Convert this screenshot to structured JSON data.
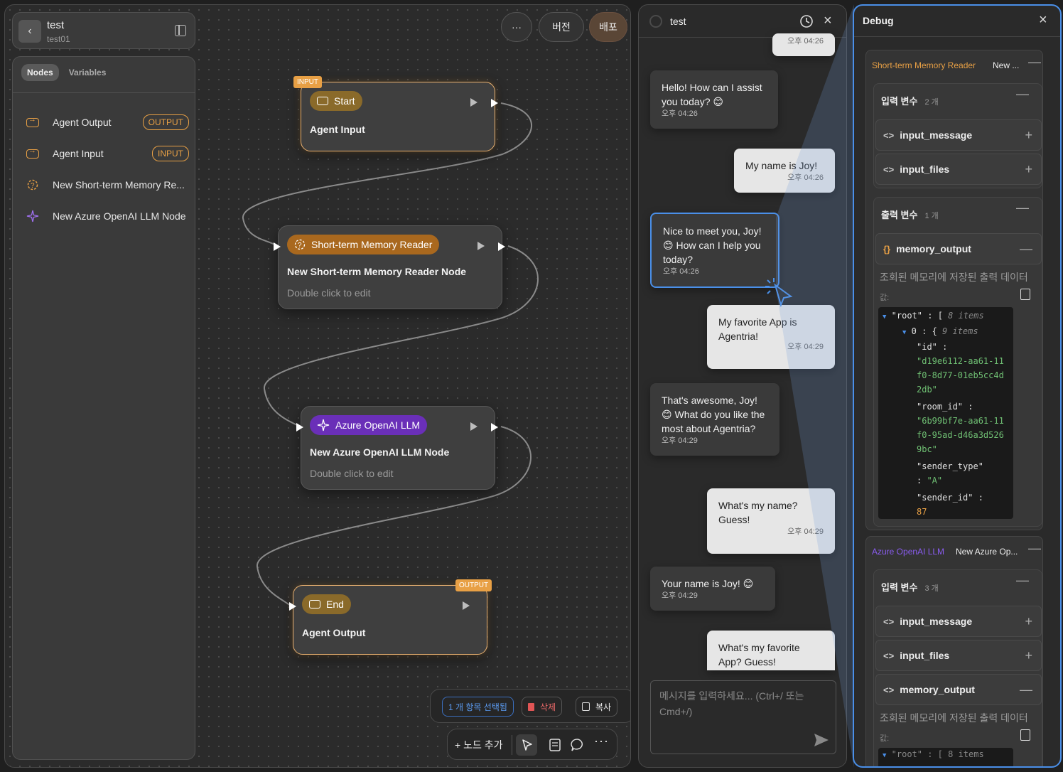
{
  "project": {
    "title": "test",
    "subtitle": "test01"
  },
  "node_panel": {
    "tabs": [
      "Nodes",
      "Variables"
    ],
    "items": [
      {
        "label": "Agent Output",
        "badge": "OUTPUT",
        "icon": "io-icon"
      },
      {
        "label": "Agent Input",
        "badge": "INPUT",
        "icon": "io-icon"
      },
      {
        "label": "New Short-term Memory Re...",
        "badge": "",
        "icon": "memory-icon"
      },
      {
        "label": "New Azure OpenAI LLM Node",
        "badge": "",
        "icon": "sparkle-icon"
      }
    ]
  },
  "top_actions": {
    "more": "···",
    "version": "버전",
    "deploy": "배포"
  },
  "nodes": {
    "start": {
      "tag": "INPUT",
      "pill": "Start",
      "title": "Agent Input"
    },
    "memory": {
      "pill": "Short-term Memory Reader",
      "title": "New Short-term Memory Reader Node",
      "sub": "Double click to edit"
    },
    "llm": {
      "pill": "Azure OpenAI LLM",
      "title": "New Azure OpenAI LLM Node",
      "sub": "Double click to edit"
    },
    "end": {
      "tag": "OUTPUT",
      "pill": "End",
      "title": "Agent Output"
    }
  },
  "selection_bar": {
    "selected": "1 개 항목 선택됨",
    "delete": "삭제",
    "copy": "복사"
  },
  "tool_bar": {
    "add_node": "+ 노드 추가"
  },
  "chat": {
    "title": "test",
    "partial_time": "오후 04:26",
    "messages": [
      {
        "role": "bot",
        "text": "Hello! How can I assist you today? 😊",
        "time": "오후 04:26"
      },
      {
        "role": "user",
        "text": "My name is Joy!",
        "time": "오후 04:26"
      },
      {
        "role": "bot",
        "text": "Nice to meet you, Joy! 😊 How can I help you today?",
        "time": "오후 04:26"
      },
      {
        "role": "user",
        "text": "My favorite App is Agentria!",
        "time": "오후 04:29"
      },
      {
        "role": "bot",
        "text": "That's awesome, Joy! 😊 What do you like the most about Agentria?",
        "time": "오후 04:29"
      },
      {
        "role": "user",
        "text": "What's my name? Guess!",
        "time": "오후 04:29"
      },
      {
        "role": "bot",
        "text": "Your name is Joy! 😊",
        "time": "오후 04:29"
      },
      {
        "role": "user",
        "text": "What's my favorite App? Guess!",
        "time": ""
      }
    ],
    "input_placeholder": "메시지를 입력하세요... (Ctrl+/ 또는 Cmd+/)"
  },
  "debug": {
    "title": "Debug",
    "sections": [
      {
        "type_label": "Short-term Memory Reader",
        "name": "New ...",
        "type_color": "#e8a045",
        "inputs_label": "입력 변수",
        "inputs_count": "2 개",
        "inputs": [
          "input_message",
          "input_files"
        ],
        "outputs_label": "출력 변수",
        "outputs_count": "1 개",
        "outputs": [
          "memory_output"
        ],
        "output_desc": "조회된 메모리에 저장된 출력 데이터",
        "value_label": "값:",
        "json": {
          "root_key": "\"root\"",
          "root_meta": "8 items",
          "idx_key": "0",
          "idx_meta": "9 items",
          "fields": [
            {
              "key": "\"id\"",
              "value": "\"d19e6112-aa61-11f0-8d77-01eb5cc4d2db\"",
              "kind": "string"
            },
            {
              "key": "\"room_id\"",
              "value": "\"6b99bf7e-aa61-11f0-95ad-d46a3d5269bc\"",
              "kind": "string"
            },
            {
              "key": "\"sender_type\"",
              "value": "\"A\"",
              "kind": "string"
            },
            {
              "key": "\"sender_id\"",
              "value": "87",
              "kind": "number"
            }
          ]
        }
      },
      {
        "type_label": "Azure OpenAI LLM",
        "name": "New Azure Op...",
        "type_color": "#8a5cf0",
        "inputs_label": "입력 변수",
        "inputs_count": "3 개",
        "inputs": [
          "input_message",
          "input_files",
          "memory_output"
        ],
        "output_desc": "조회된 메모리에 저장된 출력 데이터",
        "value_label": "값:",
        "json_partial": "\"root\" : [  8 items"
      }
    ]
  }
}
